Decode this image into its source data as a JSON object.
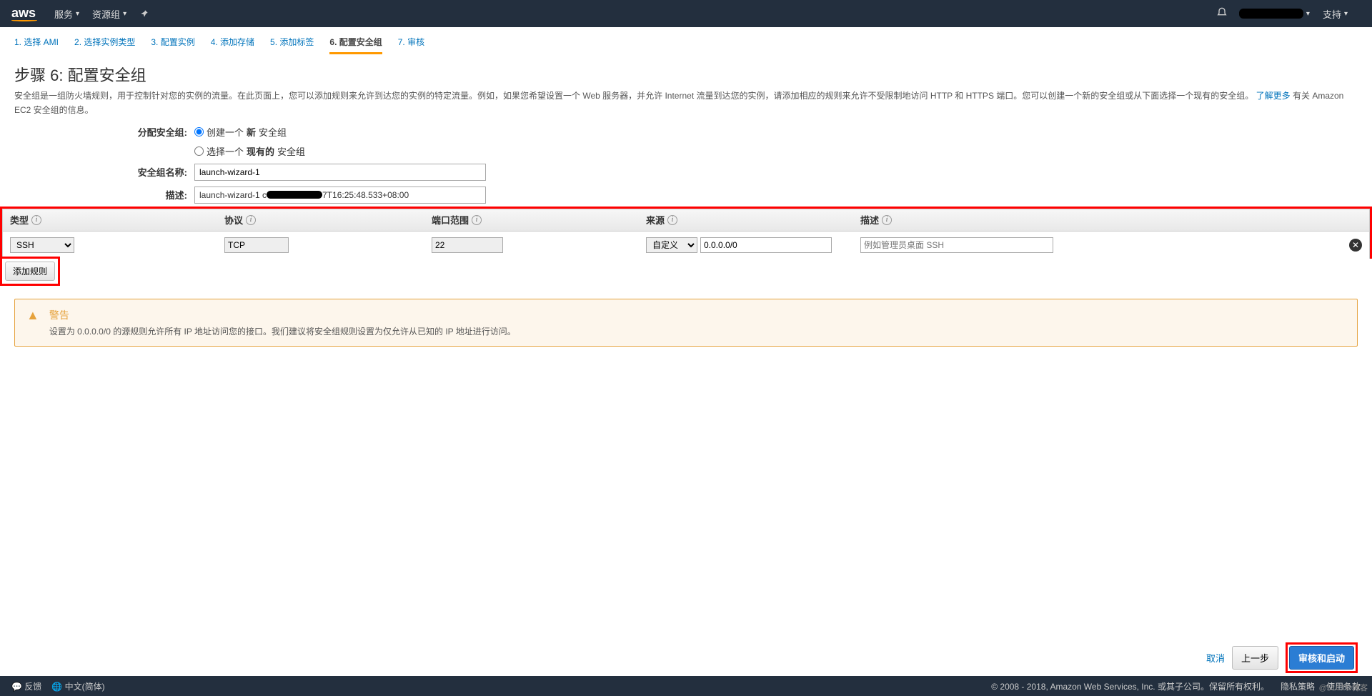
{
  "topbar": {
    "logo": "aws",
    "menu_services": "服务",
    "menu_resource_groups": "资源组",
    "menu_support": "支持"
  },
  "wizard_tabs": [
    "1. 选择 AMI",
    "2. 选择实例类型",
    "3. 配置实例",
    "4. 添加存储",
    "5. 添加标签",
    "6. 配置安全组",
    "7. 审核"
  ],
  "page": {
    "title": "步骤 6: 配置安全组",
    "desc_full": "安全组是一组防火墙规则，用于控制针对您的实例的流量。在此页面上，您可以添加规则来允许到达您的实例的特定流量。例如，如果您希望设置一个 Web 服务器，并允许 Internet 流量到达您的实例，请添加相应的规则来允许不受限制地访问 HTTP 和 HTTPS 端口。您可以创建一个新的安全组或从下面选择一个现有的安全组。",
    "learn_more": "了解更多",
    "learn_more_after": "有关 Amazon EC2 安全组的信息。"
  },
  "form": {
    "assign_label": "分配安全组:",
    "opt_create_prefix": "创建一个",
    "opt_create_bold": "新",
    "opt_create_suffix": "安全组",
    "opt_select_prefix": "选择一个",
    "opt_select_bold": "现有的",
    "opt_select_suffix": "安全组",
    "name_label": "安全组名称:",
    "name_value": "launch-wizard-1",
    "desc_label": "描述:",
    "desc_value_prefix": "launch-wizard-1 c",
    "desc_value_suffix": "7T16:25:48.533+08:00"
  },
  "rules": {
    "headers": {
      "type": "类型",
      "protocol": "协议",
      "port_range": "端口范围",
      "source": "来源",
      "description": "描述"
    },
    "rows": [
      {
        "type": "SSH",
        "protocol": "TCP",
        "port": "22",
        "source_mode": "自定义",
        "cidr": "0.0.0.0/0",
        "desc_placeholder": "例如管理员桌面 SSH"
      }
    ],
    "add_rule": "添加规则"
  },
  "warning": {
    "title": "警告",
    "text": "设置为 0.0.0.0/0 的源规则允许所有 IP 地址访问您的接口。我们建议将安全组规则设置为仅允许从已知的 IP 地址进行访问。"
  },
  "actions": {
    "cancel": "取消",
    "previous": "上一步",
    "review": "审核和启动"
  },
  "footer": {
    "feedback": "反馈",
    "language": "中文(简体)",
    "copyright": "© 2008 - 2018, Amazon Web Services, Inc. 或其子公司。保留所有权利。",
    "privacy": "隐私策略",
    "terms": "使用条款"
  },
  "watermark": "@51CTO博客"
}
